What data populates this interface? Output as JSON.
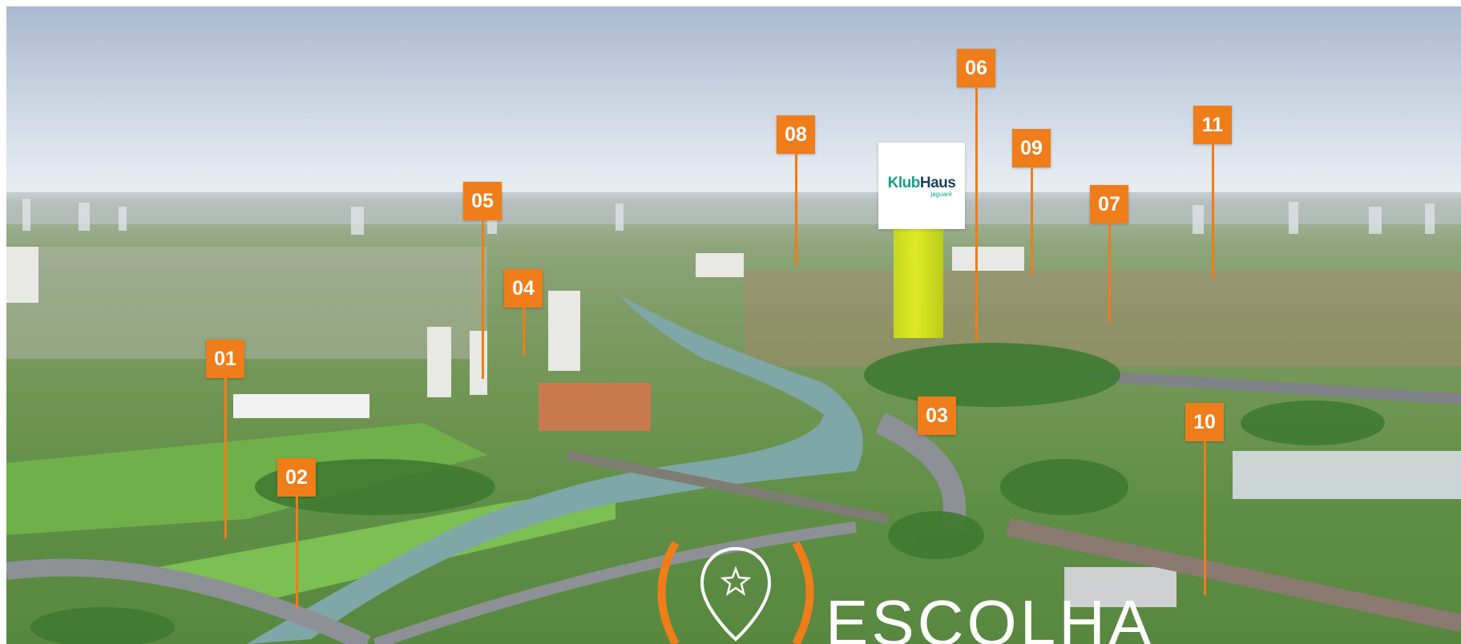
{
  "scene": {
    "description": "aerial"
  },
  "markers": [
    {
      "label": "01"
    },
    {
      "label": "02"
    },
    {
      "label": "03"
    },
    {
      "label": "04"
    },
    {
      "label": "05"
    },
    {
      "label": "06"
    },
    {
      "label": "07"
    },
    {
      "label": "08"
    },
    {
      "label": "09"
    },
    {
      "label": "10"
    },
    {
      "label": "11"
    }
  ],
  "logo": {
    "brand_k": "Klub",
    "brand_h": "Haus",
    "sub": "jaguaré"
  },
  "footer": {
    "word": "ESCOLHA"
  },
  "colors": {
    "marker": "#ef7d1a",
    "tower": "#e6f020",
    "logo_teal": "#1aa08a",
    "logo_navy": "#1d3f5e"
  }
}
